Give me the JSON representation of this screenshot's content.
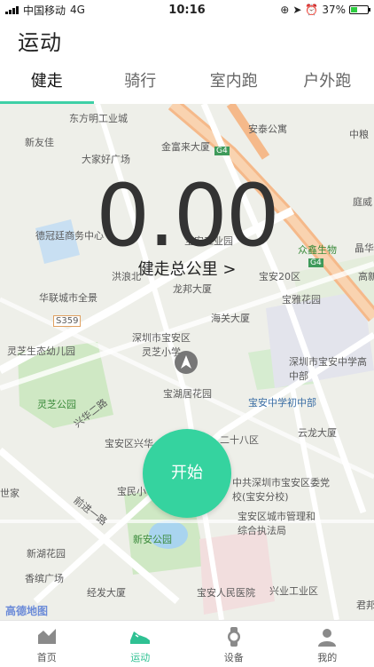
{
  "status": {
    "carrier": "中国移动",
    "network": "4G",
    "time": "10:16",
    "battery": "37%"
  },
  "header": {
    "title": "运动"
  },
  "tabs": [
    {
      "label": "健走",
      "active": true
    },
    {
      "label": "骑行",
      "active": false
    },
    {
      "label": "室内跑",
      "active": false
    },
    {
      "label": "户外跑",
      "active": false
    }
  ],
  "stats": {
    "distance": "0.00",
    "unit_label": "健走总公里 >"
  },
  "start_button": {
    "label": "开始"
  },
  "map": {
    "labels": [
      "东方明工业城",
      "新友佳",
      "大家好广场",
      "金富来大厦",
      "安泰公寓",
      "德冠廷商务中心",
      "晶华",
      "华联城市全景",
      "龙邦大厦",
      "宝安20区",
      "宝雅花园",
      "S359",
      "海关大厦",
      "灵芝生态幼儿园",
      "深圳市宝安区灵芝小学",
      "深圳市宝安中学高中部",
      "宝湖居花园",
      "灵芝公园",
      "宝安中学初中部",
      "宝安区兴华",
      "二十八区",
      "云龙大厦",
      "世家",
      "宝民小",
      "中共深圳市宝安区委党校(宝安分校)",
      "宝安区城市管理和综合执法局",
      "新湖花园",
      "新安公园",
      "香缤广场",
      "经发大厦",
      "宝安人民医院",
      "兴业工业区",
      "君邦",
      "庭威",
      "高新",
      "G4",
      "兴华二路",
      "前进一路",
      "洪浪北",
      "宝安工业园",
      "众鑫生物",
      "中粮"
    ],
    "logo": "高德地图"
  },
  "bottom_nav": [
    {
      "label": "首页",
      "icon": "home-chart-icon",
      "active": false
    },
    {
      "label": "运动",
      "icon": "sneaker-icon",
      "active": true
    },
    {
      "label": "设备",
      "icon": "watch-icon",
      "active": false
    },
    {
      "label": "我的",
      "icon": "user-icon",
      "active": false
    }
  ],
  "colors": {
    "accent": "#35d39f",
    "tab_indicator": "#3ed0a6",
    "road_orange": "#f7c08a"
  }
}
